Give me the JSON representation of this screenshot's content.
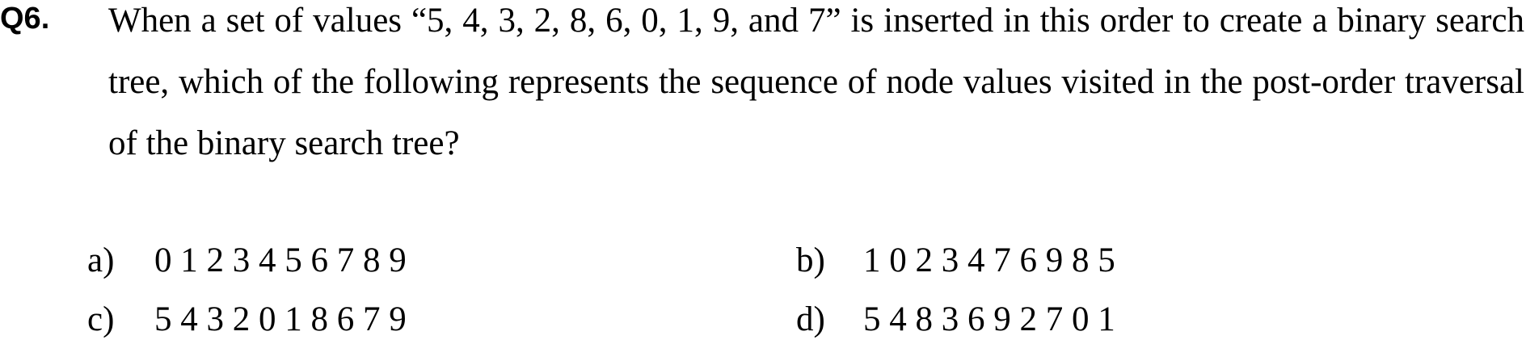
{
  "question": {
    "number": "Q6.",
    "text": "When a set of values “5, 4, 3, 2, 8, 6, 0, 1, 9, and 7” is inserted in this order to create a binary search tree, which of the following represents the sequence of node values visited in the post-order traversal of the binary search tree?"
  },
  "options": [
    {
      "letter": "a)",
      "value": "0 1 2 3 4 5 6 7 8 9"
    },
    {
      "letter": "b)",
      "value": "1 0 2 3 4 7 6 9 8 5"
    },
    {
      "letter": "c)",
      "value": "5 4 3 2 0 1 8 6 7 9"
    },
    {
      "letter": "d)",
      "value": "5 4 8 3 6 9 2 7 0 1"
    }
  ]
}
